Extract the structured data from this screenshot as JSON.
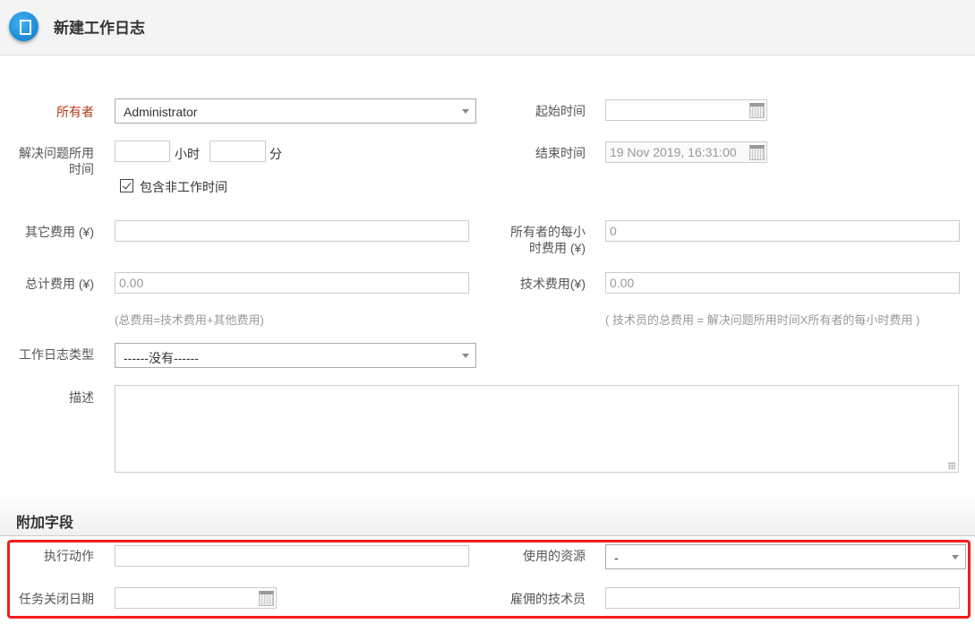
{
  "header": {
    "title": "新建工作日志",
    "icon": "document-icon"
  },
  "form": {
    "owner": {
      "label": "所有者",
      "value": "Administrator"
    },
    "start_time": {
      "label": "起始时间",
      "value": ""
    },
    "duration": {
      "label_line1": "解决问题所用",
      "label_line2": "时间",
      "hours_value": "",
      "hours_unit": "小时",
      "minutes_value": "",
      "minutes_unit": "分"
    },
    "end_time": {
      "label": "结束时间",
      "value": "19 Nov 2019, 16:31:00"
    },
    "include_non_work": {
      "label": "包含非工作时间",
      "checked": true
    },
    "other_cost": {
      "label": "其它费用 (¥)",
      "value": ""
    },
    "owner_hourly": {
      "label_line1": "所有者的每小",
      "label_line2": "时费用 (¥)",
      "value": "0"
    },
    "total_cost": {
      "label": "总计费用 (¥)",
      "value": "0.00",
      "hint": "(总费用=技术费用+其他费用)"
    },
    "tech_cost": {
      "label": "技术费用(¥)",
      "value": "0.00",
      "hint": "( 技术员的总费用 = 解决问题所用时间X所有者的每小时费用 )"
    },
    "worklog_type": {
      "label": "工作日志类型",
      "value": "------没有------"
    },
    "description": {
      "label": "描述",
      "value": ""
    }
  },
  "additional": {
    "title": "附加字段",
    "action": {
      "label": "执行动作",
      "value": ""
    },
    "resource": {
      "label": "使用的资源",
      "value": "-"
    },
    "close_date": {
      "label": "任务关闭日期",
      "value": ""
    },
    "hired_tech": {
      "label": "雇佣的技术员",
      "value": ""
    }
  },
  "colors": {
    "highlight": "#f21d1d",
    "required_label": "#b33a14",
    "icon": "#0a77c6"
  }
}
